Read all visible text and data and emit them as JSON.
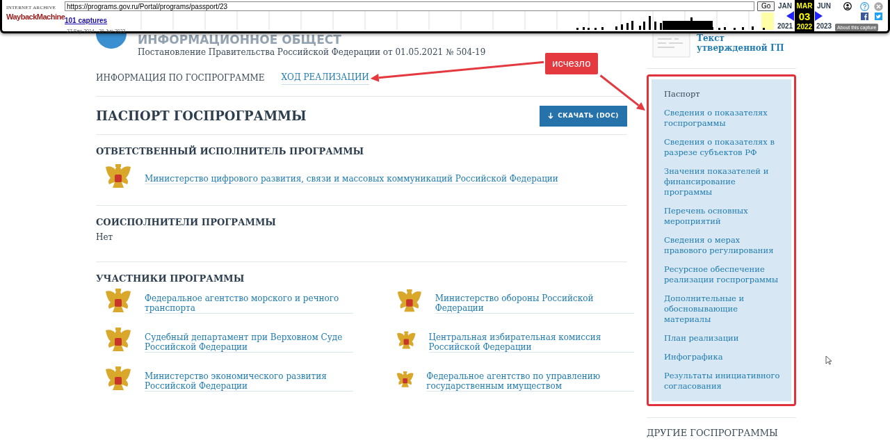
{
  "wayback": {
    "archive_label": "INTERNET ARCHIVE",
    "wordmark": "WaybackMachine",
    "url": "https://programs.gov.ru/Portal/programs/passport/23",
    "go": "Go",
    "captures": "101 captures",
    "date_range": "27 Sep 2014 - 29 Jun 2023",
    "calendar": [
      {
        "month": "JAN",
        "year": "2021",
        "selected": false
      },
      {
        "month": "MAR",
        "year": "2022",
        "selected": true
      },
      {
        "month": "JUN",
        "year": "2023",
        "selected": false
      }
    ],
    "day": "03",
    "about": "About this capture"
  },
  "header": {
    "title": "ИНФОРМАЦИОННОЕ ОБЩЕСТ",
    "subtitle": "Постановление Правительства Российской Федерации от 01.05.2021 № 504-19"
  },
  "tabs": [
    {
      "label": "ИНФОРМАЦИЯ ПО ГОСПРОГРАММЕ",
      "selected": true
    },
    {
      "label": "ХОД РЕАЛИЗАЦИИ",
      "selected": false
    }
  ],
  "passport": {
    "heading": "ПАСПОРТ ГОСПРОГРАММЫ",
    "download": "СКАЧАТЬ (DOC)"
  },
  "executor": {
    "heading": "ОТВЕТСТВЕННЫЙ ИСПОЛНИТЕЛЬ ПРОГРАММЫ",
    "name": "Министерство цифрового развития, связи и массовых коммуникаций Российской Федерации"
  },
  "coexecutors": {
    "heading": "СОИСПОЛНИТЕЛИ ПРОГРАММЫ",
    "value": "Нет"
  },
  "participants": {
    "heading": "УЧАСТНИКИ ПРОГРАММЫ",
    "items": [
      {
        "name": "Федеральное агентство морского и речного транспорта"
      },
      {
        "name": "Министерство обороны Российской Федерации"
      },
      {
        "name": "Судебный департамент при Верховном Суде Российской Федерации"
      },
      {
        "name": "Центральная избирательная комиссия Российской Федерации"
      },
      {
        "name": "Министерство экономического развития Российской Федерации"
      },
      {
        "name": "Федеральное агентство по управлению государственным имуществом"
      }
    ]
  },
  "sidebar": {
    "doc_link": "Текст утвержденной ГП",
    "items": [
      {
        "label": "Паспорт",
        "selected": true
      },
      {
        "label": "Сведения о показателях госпрограммы",
        "selected": false
      },
      {
        "label": "Сведения о показателях в разрезе субъектов РФ",
        "selected": false
      },
      {
        "label": "Значения показателей и финансирование программы",
        "selected": false
      },
      {
        "label": "Перечень основных мероприятий",
        "selected": false
      },
      {
        "label": "Сведения о мерах правового регулирования",
        "selected": false
      },
      {
        "label": "Ресурсное обеспечение реализации госпрограммы",
        "selected": false
      },
      {
        "label": "Дополнительные и обосновывающие материалы",
        "selected": false
      },
      {
        "label": "План реализации",
        "selected": false
      },
      {
        "label": "Инфографика",
        "selected": false
      },
      {
        "label": "Результаты инициативного согласования",
        "selected": false
      }
    ],
    "other_heading": "ДРУГИЕ ГОСПРОГРАММЫ"
  },
  "annotation": {
    "label": "исчезло"
  }
}
